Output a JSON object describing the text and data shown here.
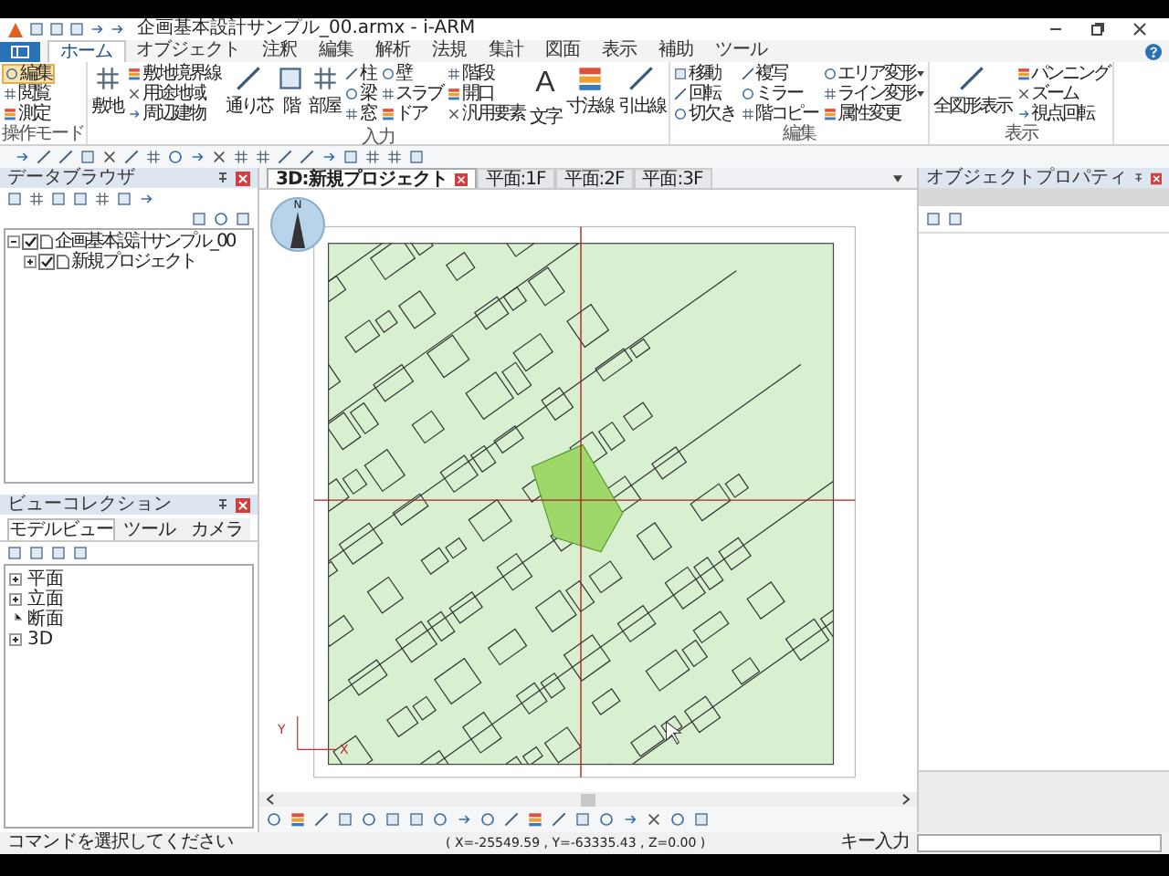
{
  "title_bar": {
    "title": "企画基本設計サンプル_00.armx - i-ARM"
  },
  "ribbon_tabs": [
    {
      "label": "ホーム",
      "selected": true
    },
    {
      "label": "オブジェクト",
      "selected": false
    },
    {
      "label": "注釈",
      "selected": false
    },
    {
      "label": "編集",
      "selected": false
    },
    {
      "label": "解析",
      "selected": false
    },
    {
      "label": "法規",
      "selected": false
    },
    {
      "label": "集計",
      "selected": false
    },
    {
      "label": "図面",
      "selected": false
    },
    {
      "label": "表示",
      "selected": false
    },
    {
      "label": "補助",
      "selected": false
    },
    {
      "label": "ツール",
      "selected": false
    }
  ],
  "ribbon_groups": [
    {
      "label": "操作モード",
      "columns": [
        {
          "kind": "stack",
          "items": [
            {
              "label": "編集",
              "selected": true
            },
            {
              "label": "閲覧",
              "selected": false
            },
            {
              "label": "測定",
              "selected": false
            }
          ]
        }
      ]
    },
    {
      "label": "入力",
      "columns": [
        {
          "kind": "large",
          "items": [
            {
              "label": "敷地"
            }
          ]
        },
        {
          "kind": "stack",
          "items": [
            {
              "label": "敷地境界線"
            },
            {
              "label": "用途地域"
            },
            {
              "label": "周辺建物"
            }
          ]
        },
        {
          "kind": "large",
          "items": [
            {
              "label": "通り芯"
            }
          ]
        },
        {
          "kind": "large",
          "items": [
            {
              "label": "階"
            }
          ]
        },
        {
          "kind": "large",
          "items": [
            {
              "label": "部屋"
            }
          ]
        },
        {
          "kind": "stack",
          "items": [
            {
              "label": "柱"
            },
            {
              "label": "梁"
            },
            {
              "label": "窓"
            }
          ]
        },
        {
          "kind": "stack",
          "items": [
            {
              "label": "壁"
            },
            {
              "label": "スラブ"
            },
            {
              "label": "ドア"
            }
          ]
        },
        {
          "kind": "stack",
          "items": [
            {
              "label": "階段"
            },
            {
              "label": "開口"
            },
            {
              "label": "汎用要素"
            }
          ]
        },
        {
          "kind": "large",
          "items": [
            {
              "label": "文字",
              "glyph": "A"
            }
          ]
        },
        {
          "kind": "large",
          "items": [
            {
              "label": "寸法線"
            }
          ]
        },
        {
          "kind": "large",
          "items": [
            {
              "label": "引出線"
            }
          ]
        }
      ]
    },
    {
      "label": "編集",
      "columns": [
        {
          "kind": "stack",
          "items": [
            {
              "label": "移動"
            },
            {
              "label": "回転"
            },
            {
              "label": "切欠き"
            }
          ]
        },
        {
          "kind": "stack",
          "items": [
            {
              "label": "複写"
            },
            {
              "label": "ミラー"
            },
            {
              "label": "階コピー"
            }
          ]
        },
        {
          "kind": "stack",
          "items": [
            {
              "label": "エリア変形",
              "dropdown": true
            },
            {
              "label": "ライン変形",
              "dropdown": true
            },
            {
              "label": "属性変更"
            }
          ]
        }
      ]
    },
    {
      "label": "表示",
      "columns": [
        {
          "kind": "large",
          "items": [
            {
              "label": "全図形表示"
            }
          ]
        },
        {
          "kind": "stack",
          "items": [
            {
              "label": "パンニング"
            },
            {
              "label": "ズーム"
            },
            {
              "label": "視点回転"
            }
          ]
        }
      ]
    }
  ],
  "data_browser": {
    "title": "データブラウザ",
    "tree": [
      {
        "label": "企画基本設計サンプル_00",
        "checked": true,
        "expanded": true,
        "children": [
          {
            "label": "新規プロジェクト",
            "checked": true,
            "expanded": false
          }
        ]
      }
    ]
  },
  "view_collection": {
    "title": "ビューコレクション",
    "tabs": [
      {
        "label": "モデルビュー",
        "selected": true
      },
      {
        "label": "ツール",
        "selected": false
      },
      {
        "label": "カメラ",
        "selected": false
      }
    ],
    "tree": [
      {
        "label": "平面",
        "expandable": true
      },
      {
        "label": "立面",
        "expandable": true
      },
      {
        "label": "断面",
        "expandable": false
      },
      {
        "label": "3D",
        "expandable": true
      }
    ]
  },
  "document_tabs": [
    {
      "label": "3D:新規プロジェクト",
      "selected": true
    },
    {
      "label": "平面:1F",
      "selected": false
    },
    {
      "label": "平面:2F",
      "selected": false
    },
    {
      "label": "平面:3F",
      "selected": false
    }
  ],
  "canvas": {
    "compass_label": "N",
    "y_axis": "Y",
    "x_axis": "X"
  },
  "object_properties": {
    "title": "オブジェクトプロパティ"
  },
  "status_bar": {
    "message": "コマンドを選択してください",
    "coordinates": "( X=-25549.59 , Y=-63335.43 , Z=0.00 )",
    "key_input_label": "キー入力"
  }
}
